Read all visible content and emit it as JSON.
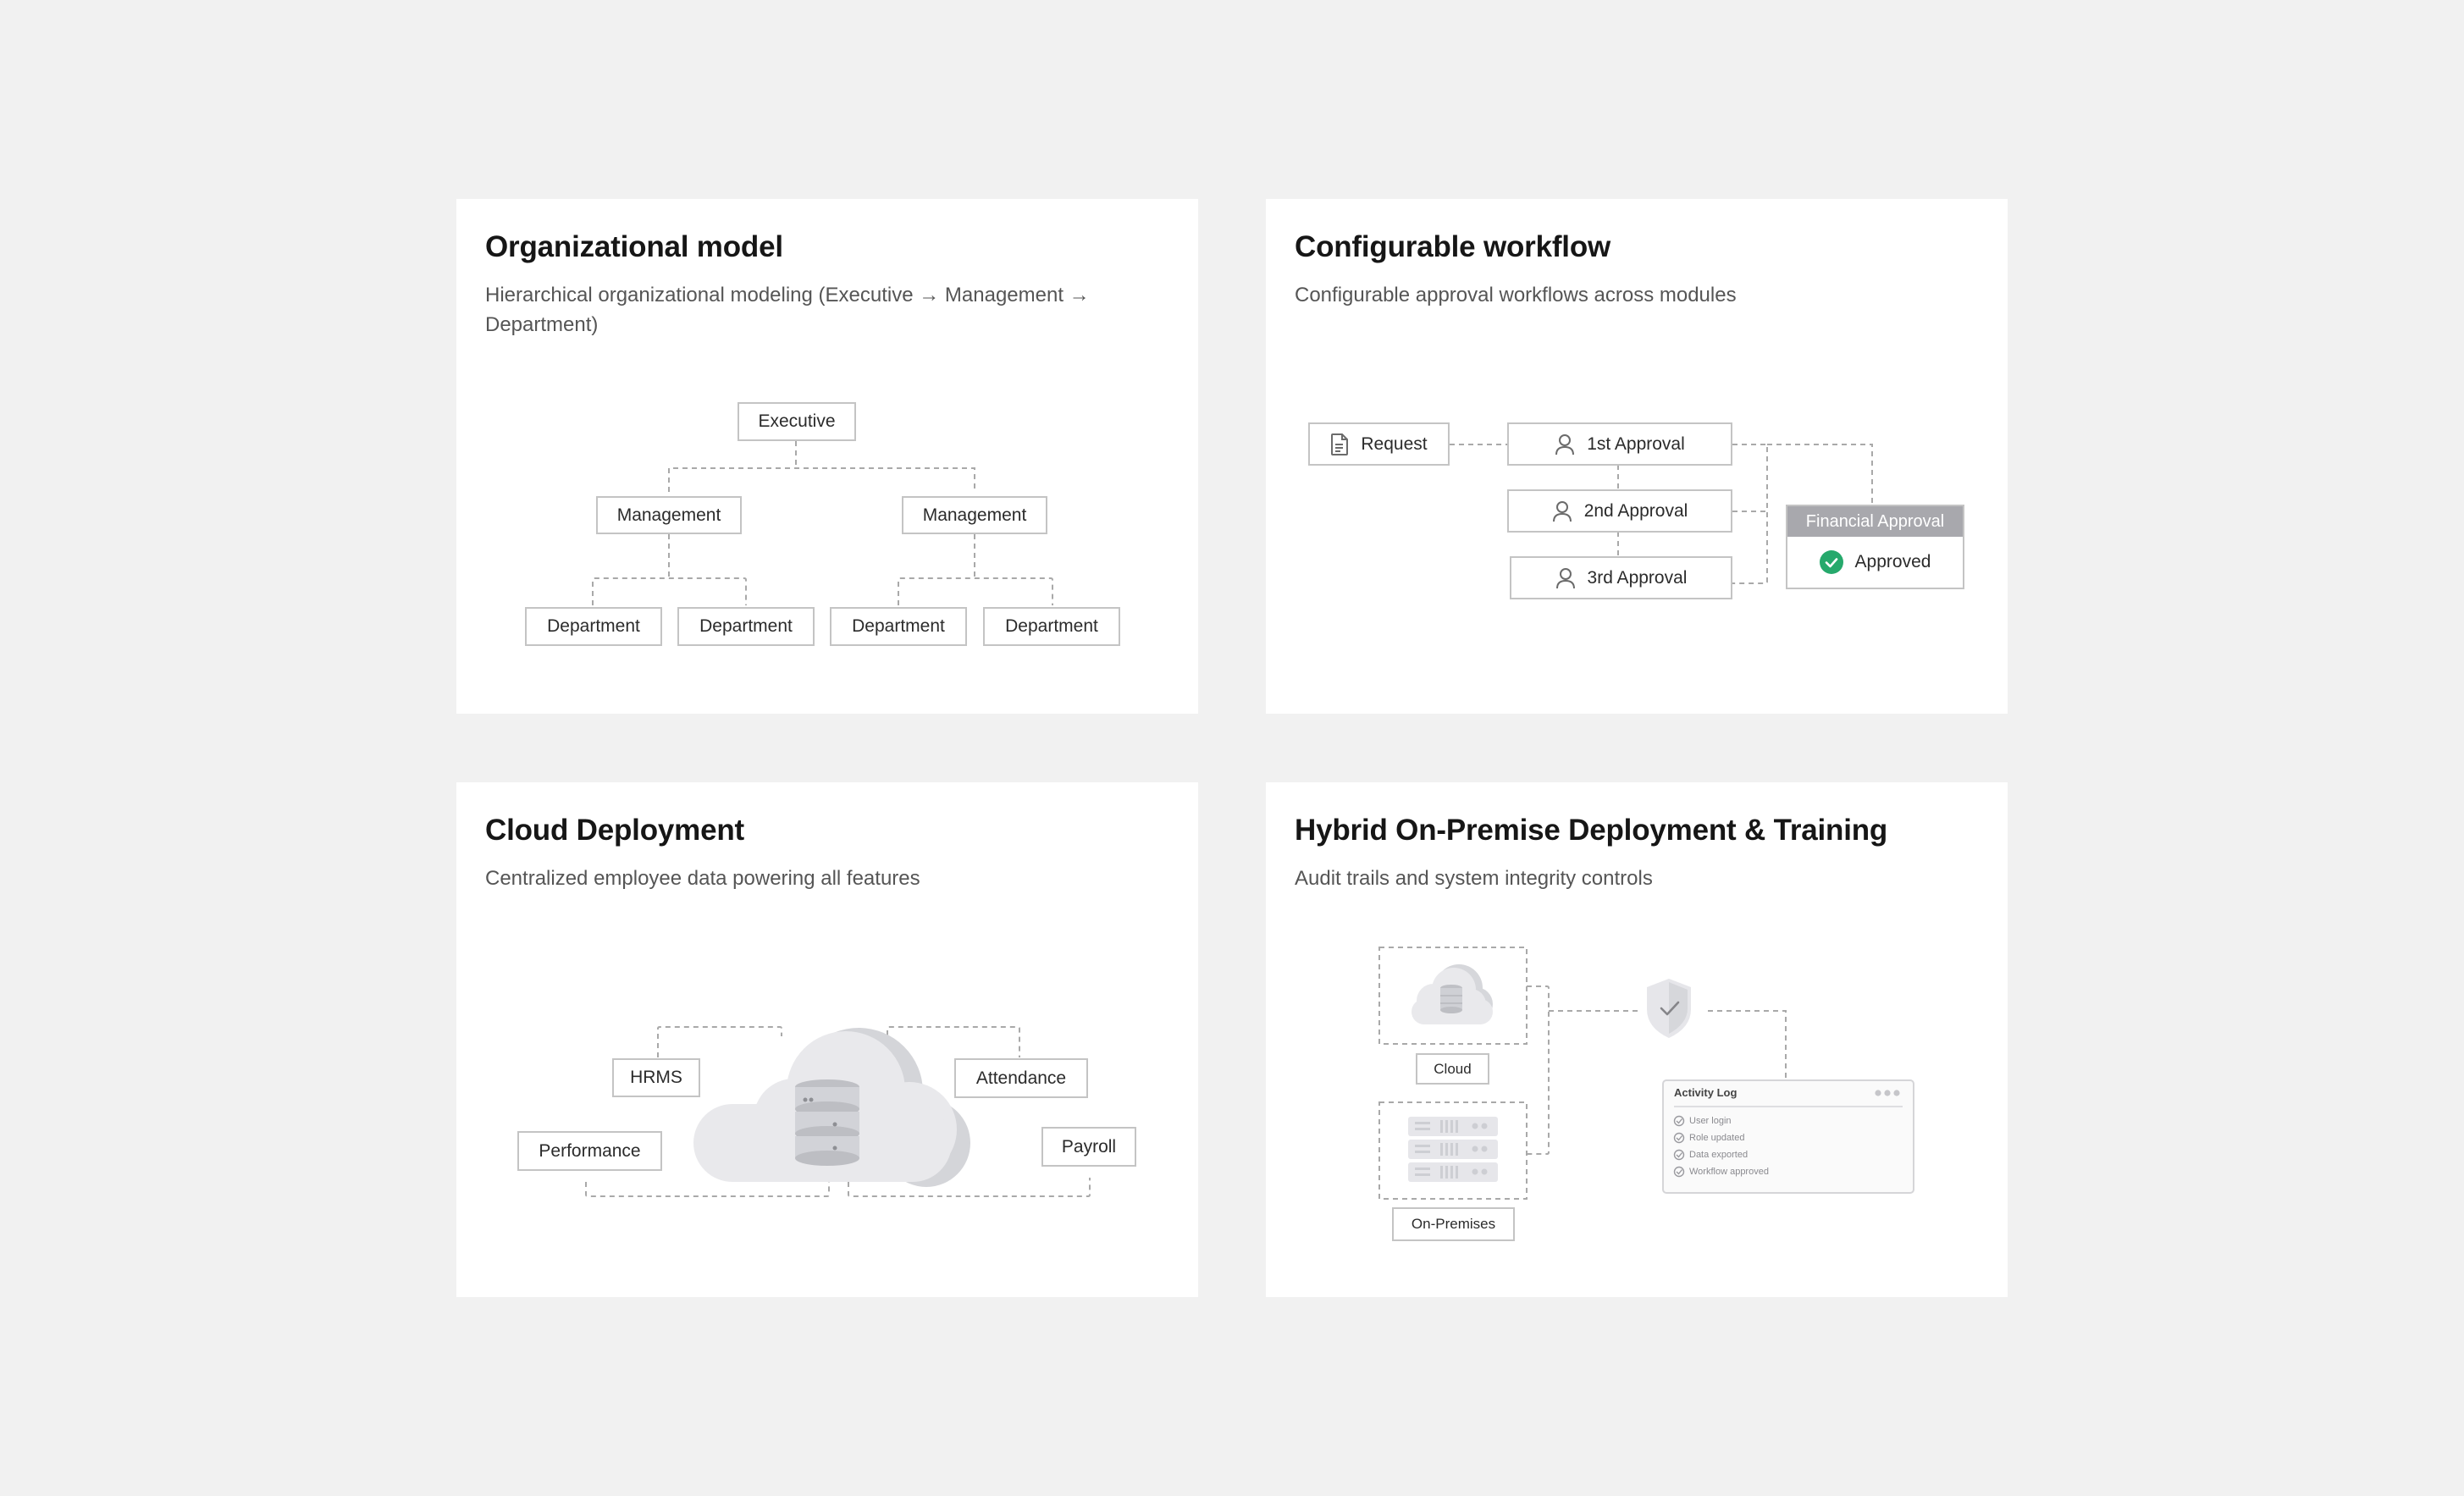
{
  "cards": [
    {
      "title": "Organizational model",
      "subtitle": "Hierarchical organizational modeling (Executive → Management → Department)",
      "nodes": {
        "executive": "Executive",
        "management": "Management",
        "department": "Department"
      }
    },
    {
      "title": "Configurable workflow",
      "subtitle": "Configurable approval workflows across modules",
      "request": "Request",
      "approvals": [
        "1st Approval",
        "2nd Approval",
        "3rd Approval"
      ],
      "financial": {
        "header": "Financial Approval",
        "status": "Approved"
      }
    },
    {
      "title": "Cloud Deployment",
      "subtitle": "Centralized employee data powering all features",
      "modules": {
        "hrms": "HRMS",
        "performance": "Performance",
        "attendance": "Attendance",
        "payroll": "Payroll"
      }
    },
    {
      "title": "Hybrid On-Premise Deployment & Training",
      "subtitle": "Audit trails and system integrity controls",
      "cloud_label": "Cloud",
      "onprem_label": "On-Premises",
      "log": {
        "title": "Activity Log",
        "items": [
          "User login",
          "Role updated",
          "Data exported",
          "Workflow approved"
        ]
      }
    }
  ],
  "colors": {
    "background": "#f1f1f1",
    "card": "#ffffff",
    "border": "#c4c4c4",
    "accent_green": "#26a96c",
    "financial_header": "#a8a8ad"
  }
}
